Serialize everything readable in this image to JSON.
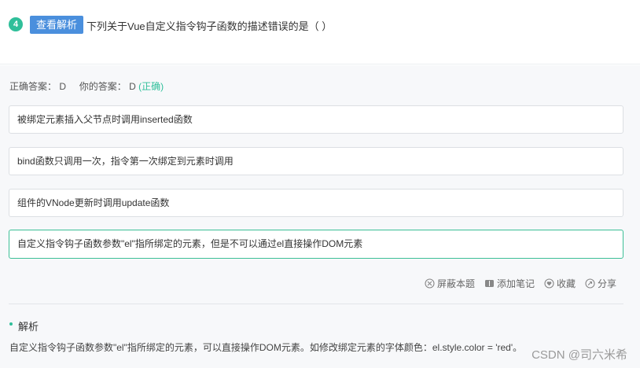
{
  "question": {
    "number": "4",
    "analysis_button": "查看解析",
    "text": "下列关于Vue自定义指令钩子函数的描述错误的是（ ）"
  },
  "answer": {
    "correct_label": "正确答案：",
    "correct_value": "D",
    "your_label": "你的答案：",
    "your_value": "D",
    "status": "(正确)"
  },
  "options": [
    {
      "text": "被绑定元素插入父节点时调用inserted函数",
      "selected": false
    },
    {
      "text": "bind函数只调用一次，指令第一次绑定到元素时调用",
      "selected": false
    },
    {
      "text": "组件的VNode更新时调用update函数",
      "selected": false
    },
    {
      "text": "自定义指令钩子函数参数\"el\"指所绑定的元素，但是不可以通过el直接操作DOM元素",
      "selected": true
    }
  ],
  "actions": [
    {
      "label": "屏蔽本题",
      "icon": "block-icon"
    },
    {
      "label": "添加笔记",
      "icon": "note-icon"
    },
    {
      "label": "收藏",
      "icon": "heart-icon"
    },
    {
      "label": "分享",
      "icon": "share-icon"
    }
  ],
  "analysis": {
    "title": "解析",
    "text": "自定义指令钩子函数参数\"el\"指所绑定的元素，可以直接操作DOM元素。如修改绑定元素的字体颜色：el.style.color = 'red'。"
  },
  "watermark": "CSDN @司六米希",
  "colors": {
    "accent_green": "#2fbf9a",
    "button_blue": "#4a8fdd",
    "selected_border": "#3cbf96"
  }
}
